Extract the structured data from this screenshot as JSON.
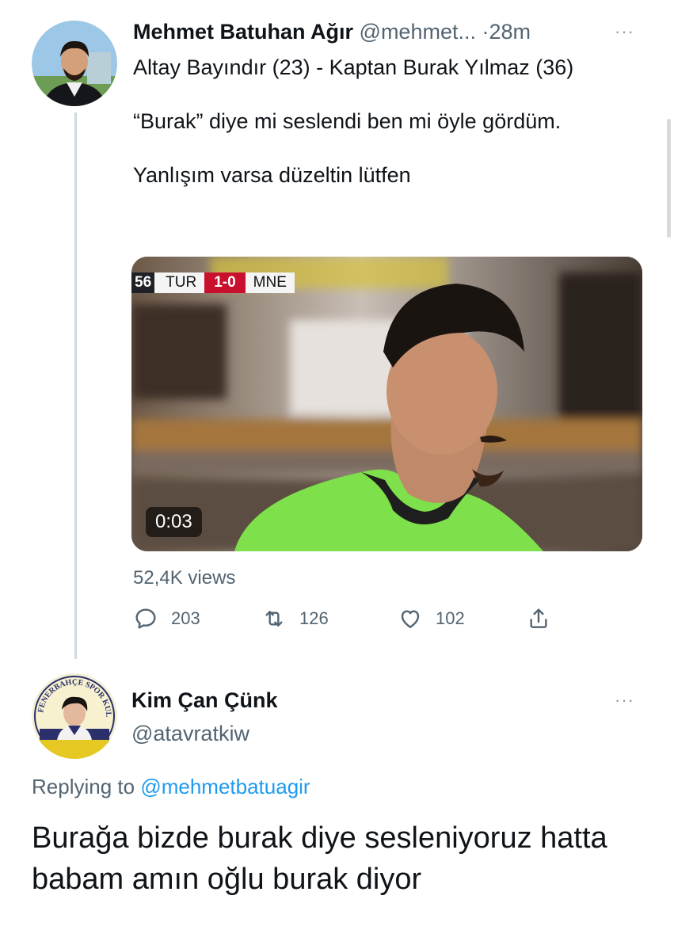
{
  "tweet": {
    "author_name": "Mehmet Batuhan Ağır",
    "author_handle": "@mehmet...",
    "separator": "·",
    "time": "28m",
    "more": "···",
    "text_lines": [
      "Altay Bayındır (23) - Kaptan Burak Yılmaz (36)",
      "“Burak” diye mi seslendi ben mi öyle gördüm.",
      "Yanlışım varsa düzeltin lütfen"
    ],
    "video": {
      "score_bug": {
        "minute": "56",
        "home": "TUR",
        "score": "1-0",
        "away": "MNE"
      },
      "duration": "0:03"
    },
    "views": "52,4K views",
    "actions": {
      "replies": "203",
      "retweets": "126",
      "likes": "102"
    },
    "icons": [
      "reply-icon",
      "retweet-icon",
      "like-icon",
      "share-icon"
    ]
  },
  "reply": {
    "author_name": "Kim Çan Çünk",
    "author_handle": "@atavratkiw",
    "more": "···",
    "replying_prefix": "Replying to",
    "replying_mention": "@mehmetbatuagir",
    "avatar_ring_text": "FENERBAHÇE SPOR KULÜBÜ",
    "text": "Burağa bizde burak diye sesleniyoruz hatta babam amın oğlu burak diyor"
  },
  "colors": {
    "accent": "#1d9bf0",
    "secondary_text": "#536471",
    "primary_text": "#0f1419",
    "score_red": "#c8102e",
    "jersey_green": "#7ee04a"
  }
}
